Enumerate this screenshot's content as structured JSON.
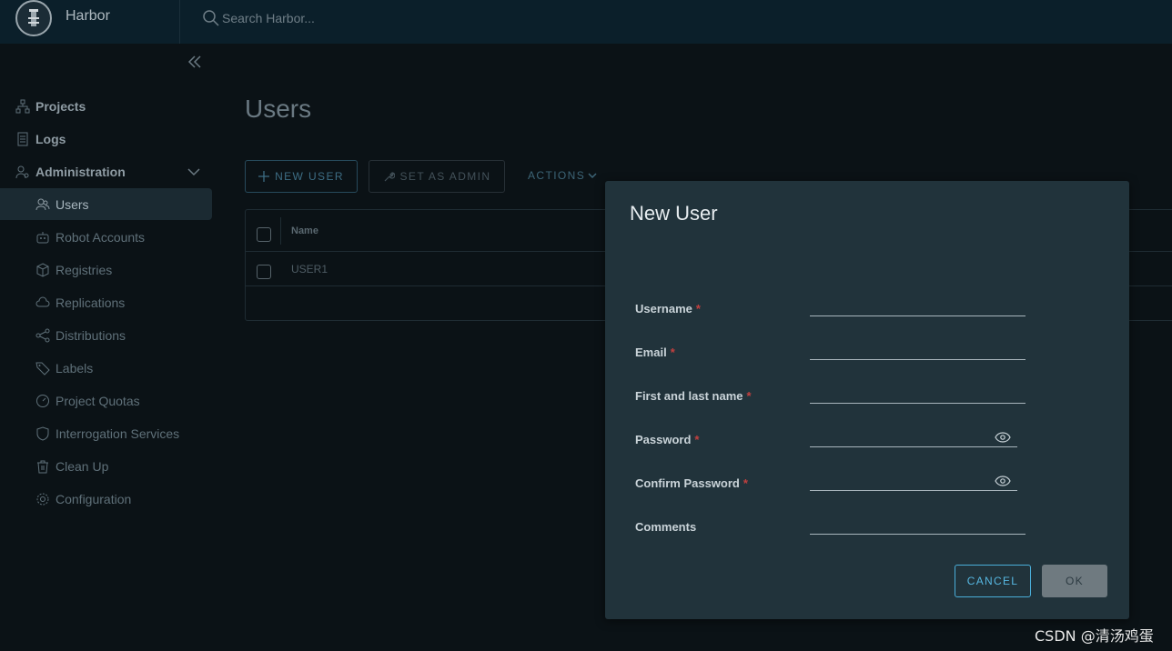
{
  "header": {
    "brand": "Harbor",
    "search_placeholder": "Search Harbor..."
  },
  "sidebar": {
    "items": [
      {
        "label": "Projects",
        "icon": "projects-icon"
      },
      {
        "label": "Logs",
        "icon": "logs-icon"
      },
      {
        "label": "Administration",
        "icon": "administration-icon",
        "expanded": true
      },
      {
        "label": "Users",
        "icon": "users-icon",
        "active": true
      },
      {
        "label": "Robot Accounts",
        "icon": "robot-icon"
      },
      {
        "label": "Registries",
        "icon": "registries-icon"
      },
      {
        "label": "Replications",
        "icon": "replications-icon"
      },
      {
        "label": "Distributions",
        "icon": "distributions-icon"
      },
      {
        "label": "Labels",
        "icon": "labels-icon"
      },
      {
        "label": "Project Quotas",
        "icon": "quotas-icon"
      },
      {
        "label": "Interrogation Services",
        "icon": "shield-icon"
      },
      {
        "label": "Clean Up",
        "icon": "trash-icon"
      },
      {
        "label": "Configuration",
        "icon": "gear-icon"
      }
    ]
  },
  "main": {
    "title": "Users",
    "toolbar": {
      "new_user": "NEW USER",
      "set_as_admin": "SET AS ADMIN",
      "actions": "ACTIONS"
    },
    "table": {
      "columns": [
        "Name"
      ],
      "rows": [
        {
          "name": "USER1"
        }
      ]
    }
  },
  "modal": {
    "title": "New User",
    "fields": {
      "username": {
        "label": "Username",
        "value": ""
      },
      "email": {
        "label": "Email",
        "value": ""
      },
      "full_name": {
        "label": "First and last name",
        "value": ""
      },
      "password": {
        "label": "Password",
        "value": ""
      },
      "confirm_password": {
        "label": "Confirm Password",
        "value": ""
      },
      "comments": {
        "label": "Comments",
        "value": ""
      }
    },
    "required_mark": "*",
    "cancel": "CANCEL",
    "ok": "OK"
  },
  "watermark": "CSDN @清汤鸡蛋",
  "colors": {
    "background": "#0b1216",
    "header": "#0b1f2a",
    "modal": "#21333b",
    "accent": "#57b8e2",
    "required": "#c2403f"
  }
}
